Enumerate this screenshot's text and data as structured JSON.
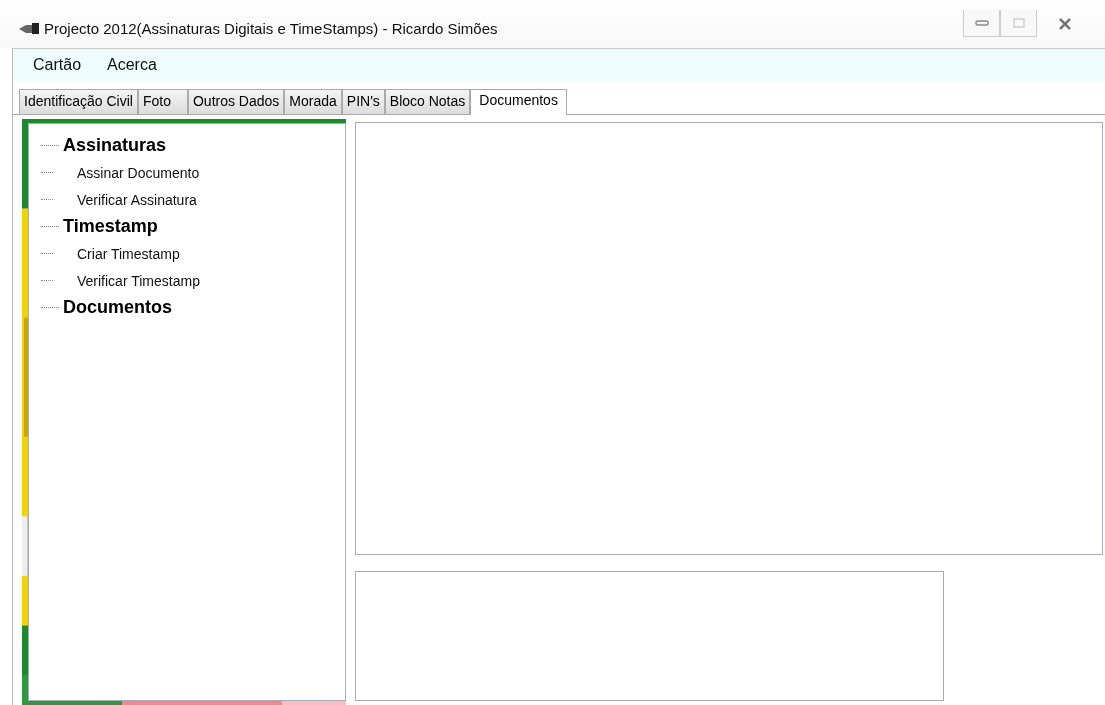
{
  "window": {
    "title": "Projecto 2012(Assinaturas Digitais e TimeStamps) - Ricardo Simões"
  },
  "menu": [
    {
      "label": "Cartão"
    },
    {
      "label": "Acerca"
    }
  ],
  "tabs": [
    {
      "label": "Identificação Civil",
      "selected": false
    },
    {
      "label": "Foto",
      "selected": false
    },
    {
      "label": "Outros Dados",
      "selected": false
    },
    {
      "label": "Morada",
      "selected": false
    },
    {
      "label": "PIN's",
      "selected": false
    },
    {
      "label": "Bloco Notas",
      "selected": false
    },
    {
      "label": "Documentos",
      "selected": true
    }
  ],
  "tree": [
    {
      "label": "Assinaturas",
      "children": [
        {
          "label": "Assinar Documento"
        },
        {
          "label": "Verificar Assinatura"
        }
      ]
    },
    {
      "label": "Timestamp",
      "children": [
        {
          "label": "Criar Timestamp"
        },
        {
          "label": "Verificar Timestamp"
        }
      ]
    },
    {
      "label": "Documentos"
    }
  ]
}
